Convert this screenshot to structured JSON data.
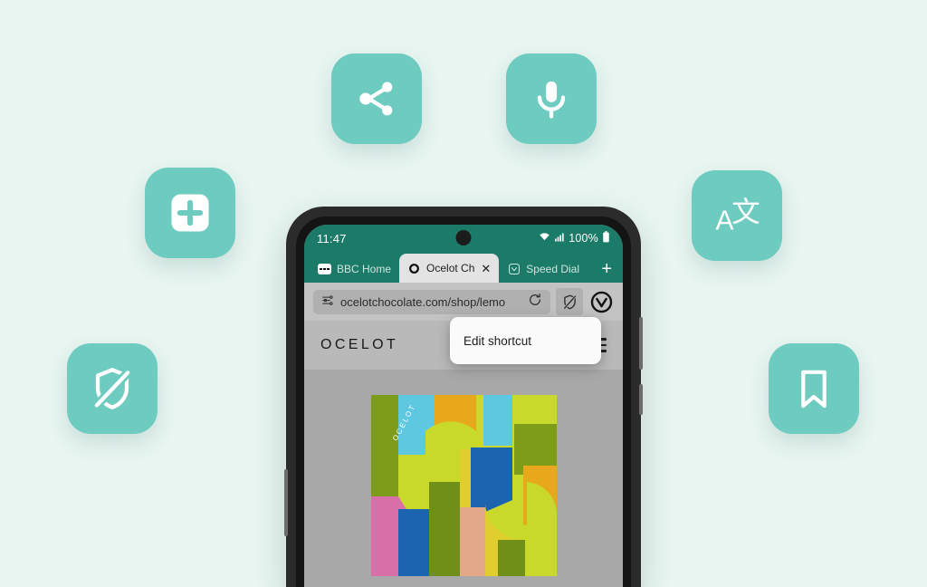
{
  "theme": {
    "background": "#e8f5f1",
    "icon_tile": "#6ecbc0",
    "browser_chrome": "#1b7a68",
    "phone_frame": "#2b2b2b"
  },
  "feature_icons": [
    {
      "name": "share-icon",
      "label": "Share"
    },
    {
      "name": "microphone-icon",
      "label": "Voice search"
    },
    {
      "name": "new-tab-icon",
      "label": "New tab"
    },
    {
      "name": "translate-icon",
      "label": "Translate"
    },
    {
      "name": "shield-off-icon",
      "label": "Tracker blocker"
    },
    {
      "name": "bookmark-icon",
      "label": "Bookmark"
    }
  ],
  "phone": {
    "statusbar": {
      "clock": "11:47",
      "battery_percent": "100%",
      "wifi_icon": "wifi-icon",
      "signal_icon": "cellular-signal-icon",
      "battery_icon": "battery-full-icon"
    },
    "tabs": [
      {
        "label": "BBC Home",
        "favicon": "bbc-favicon",
        "active": false,
        "closable": false
      },
      {
        "label": "Ocelot Ch",
        "favicon": "ocelot-favicon",
        "active": true,
        "closable": true,
        "close_glyph": "✕"
      },
      {
        "label": "Speed Dial",
        "favicon": "speed-dial-icon",
        "active": false,
        "closable": false
      }
    ],
    "new_tab_button": "+",
    "urlbar": {
      "page_info_icon": "page-settings-icon",
      "url": "ocelotchocolate.com/shop/lemo",
      "reload_icon": "reload-icon",
      "shield_icon": "shield-off-icon",
      "vivaldi_icon": "vivaldi-logo-icon"
    },
    "page": {
      "site_logo": "OCELOT",
      "menu_icon": "hamburger-menu-icon",
      "popup_menu_item": "Edit shortcut",
      "product_label": "OCELOT"
    }
  }
}
